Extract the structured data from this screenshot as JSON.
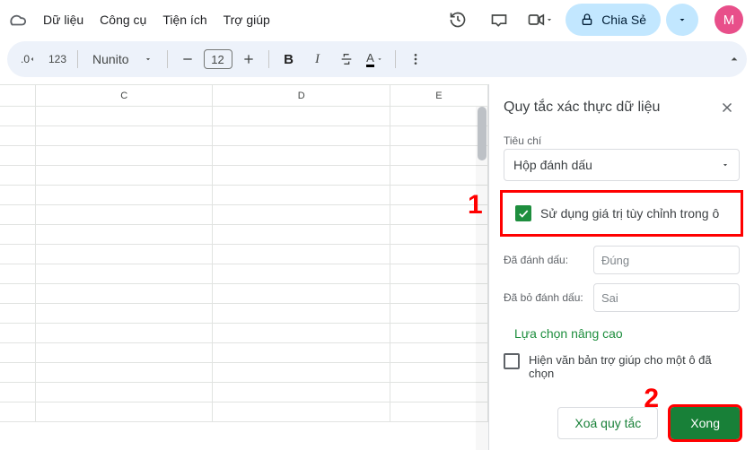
{
  "menus": {
    "data": "Dữ liệu",
    "tools": "Công cụ",
    "extensions": "Tiện ích",
    "help": "Trợ giúp"
  },
  "header": {
    "share_label": "Chia Sẻ",
    "avatar_initial": "M"
  },
  "toolbar": {
    "decimal_icon": ".0",
    "format_123": "123",
    "font_name": "Nunito",
    "font_size": "12",
    "bold": "B",
    "italic": "I",
    "text_color": "A"
  },
  "sheet": {
    "columns": [
      "C",
      "D",
      "E"
    ]
  },
  "side_panel": {
    "title": "Quy tắc xác thực dữ liệu",
    "criteria_label": "Tiêu chí",
    "criteria_value": "Hộp đánh dấu",
    "use_custom_values": "Sử dụng giá trị tùy chỉnh trong ô",
    "checked_label": "Đã đánh dấu:",
    "checked_placeholder": "Đúng",
    "unchecked_label": "Đã bỏ đánh dấu:",
    "unchecked_placeholder": "Sai",
    "advanced": "Lựa chọn nâng cao",
    "show_help_text": "Hiện văn bản trợ giúp cho một ô đã chọn",
    "delete_rule": "Xoá quy tắc",
    "done": "Xong"
  },
  "annotations": {
    "one": "1",
    "two": "2"
  }
}
